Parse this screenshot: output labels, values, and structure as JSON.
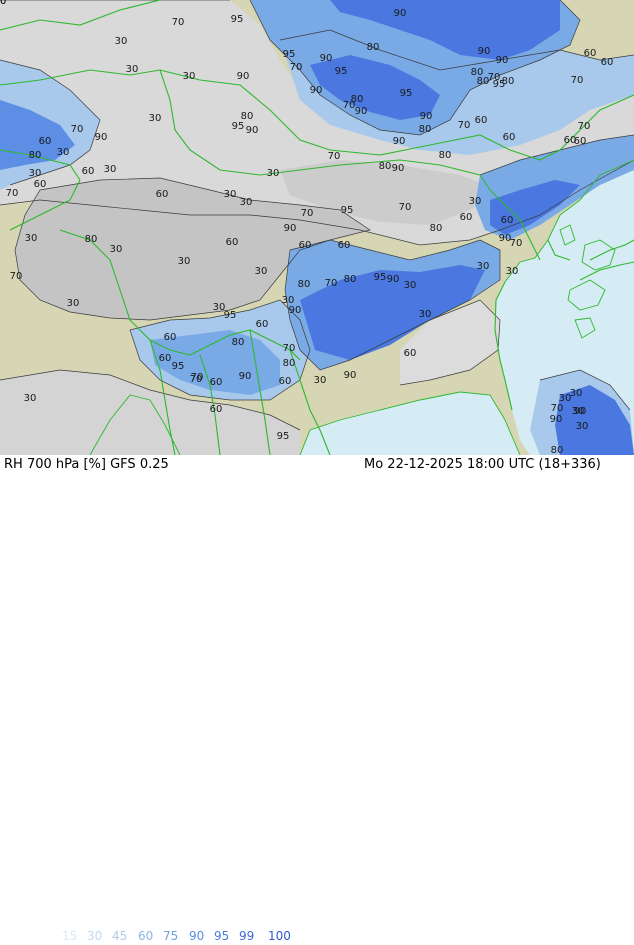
{
  "footer": {
    "title": "RH 700 hPa [%] GFS 0.25",
    "datetime": "Mo 22-12-2025 18:00 UTC (18+336)"
  },
  "legend": {
    "values": [
      "15",
      "30",
      "45",
      "60",
      "75",
      "90",
      "95",
      "99",
      "100"
    ],
    "colors": [
      "#d8e6f2",
      "#c2d8ec",
      "#aecbe6",
      "#8db7e6",
      "#73a2e0",
      "#5c8ee6",
      "#4a79e2",
      "#3f66d6",
      "#3456c8"
    ]
  },
  "map": {
    "colors": {
      "land": "#d6d6b4",
      "sea": "#d6ecf4",
      "dry_gray": "#c4c4c4",
      "light_gray": "#d9d9d9",
      "light_blue": "#a9c9ec",
      "mid_blue": "#7aaae6",
      "deep_blue": "#4a78e0",
      "border": "#2db82d",
      "contour": "#3a3a3a"
    },
    "contour_labels": [
      {
        "text": "95"
      },
      {
        "text": "70"
      },
      {
        "text": "90"
      },
      {
        "text": "30"
      },
      {
        "text": "80"
      },
      {
        "text": "30"
      },
      {
        "text": "95"
      },
      {
        "text": "90"
      },
      {
        "text": "70"
      },
      {
        "text": "90"
      },
      {
        "text": "60"
      },
      {
        "text": "90"
      },
      {
        "text": "60"
      },
      {
        "text": "80"
      },
      {
        "text": "95"
      },
      {
        "text": "90"
      },
      {
        "text": "80"
      },
      {
        "text": "70"
      },
      {
        "text": "95"
      },
      {
        "text": "80"
      },
      {
        "text": "30"
      },
      {
        "text": "70"
      },
      {
        "text": "95"
      },
      {
        "text": "90"
      },
      {
        "text": "80"
      },
      {
        "text": "70"
      },
      {
        "text": "90"
      },
      {
        "text": "90"
      },
      {
        "text": "80"
      },
      {
        "text": "70"
      },
      {
        "text": "60"
      },
      {
        "text": "80"
      },
      {
        "text": "95"
      },
      {
        "text": "90"
      },
      {
        "text": "60"
      },
      {
        "text": "30"
      },
      {
        "text": "70"
      },
      {
        "text": "90"
      },
      {
        "text": "60"
      },
      {
        "text": "60"
      },
      {
        "text": "70"
      },
      {
        "text": "60"
      },
      {
        "text": "30"
      },
      {
        "text": "90"
      },
      {
        "text": "80"
      },
      {
        "text": "60"
      },
      {
        "text": "70"
      },
      {
        "text": "80"
      },
      {
        "text": "90"
      },
      {
        "text": "30"
      },
      {
        "text": "60"
      },
      {
        "text": "30"
      },
      {
        "text": "80"
      },
      {
        "text": "70"
      },
      {
        "text": "30"
      },
      {
        "text": "30"
      },
      {
        "text": "60"
      },
      {
        "text": "30"
      },
      {
        "text": "95"
      },
      {
        "text": "70"
      },
      {
        "text": "80"
      },
      {
        "text": "60"
      },
      {
        "text": "70"
      },
      {
        "text": "30"
      },
      {
        "text": "90"
      },
      {
        "text": "60"
      },
      {
        "text": "90"
      },
      {
        "text": "70"
      },
      {
        "text": "80"
      },
      {
        "text": "30"
      },
      {
        "text": "30"
      },
      {
        "text": "30"
      },
      {
        "text": "60"
      },
      {
        "text": "30"
      },
      {
        "text": "60"
      },
      {
        "text": "60"
      },
      {
        "text": "80"
      },
      {
        "text": "70"
      },
      {
        "text": "80"
      },
      {
        "text": "95"
      },
      {
        "text": "90"
      },
      {
        "text": "30"
      },
      {
        "text": "30"
      },
      {
        "text": "30"
      },
      {
        "text": "30"
      },
      {
        "text": "90"
      },
      {
        "text": "30"
      },
      {
        "text": "30"
      },
      {
        "text": "70"
      },
      {
        "text": "60"
      },
      {
        "text": "95"
      },
      {
        "text": "60"
      },
      {
        "text": "30"
      },
      {
        "text": "80"
      },
      {
        "text": "60"
      },
      {
        "text": "70"
      },
      {
        "text": "95"
      },
      {
        "text": "80"
      },
      {
        "text": "90"
      },
      {
        "text": "60"
      },
      {
        "text": "70"
      },
      {
        "text": "70"
      },
      {
        "text": "60"
      },
      {
        "text": "30"
      },
      {
        "text": "90"
      },
      {
        "text": "60"
      },
      {
        "text": "60"
      },
      {
        "text": "30"
      },
      {
        "text": "30"
      },
      {
        "text": "30"
      },
      {
        "text": "90"
      },
      {
        "text": "30"
      },
      {
        "text": "95"
      },
      {
        "text": "70"
      },
      {
        "text": "90"
      },
      {
        "text": "30"
      },
      {
        "text": "80"
      },
      {
        "text": "70"
      },
      {
        "text": "60"
      }
    ]
  }
}
